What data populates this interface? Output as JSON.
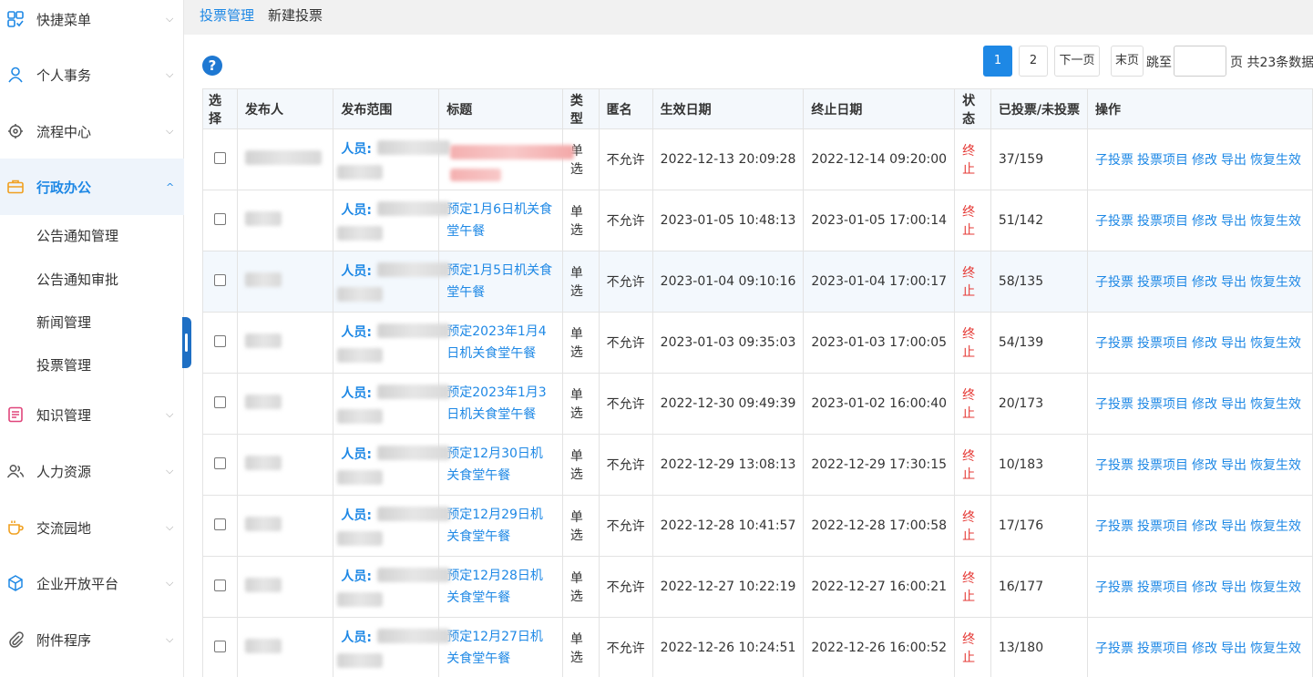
{
  "sidebar": {
    "menus": [
      {
        "label": "快捷菜单",
        "icon": "grid-check-icon"
      },
      {
        "label": "个人事务",
        "icon": "person-icon"
      },
      {
        "label": "流程中心",
        "icon": "workflow-icon"
      },
      {
        "label": "行政办公",
        "icon": "briefcase-icon",
        "active": true
      },
      {
        "label": "知识管理",
        "icon": "book-icon"
      },
      {
        "label": "人力资源",
        "icon": "people-icon"
      },
      {
        "label": "交流园地",
        "icon": "coffee-icon"
      },
      {
        "label": "企业开放平台",
        "icon": "cube-icon"
      },
      {
        "label": "附件程序",
        "icon": "paperclip-icon"
      }
    ],
    "submenu": [
      "公告通知管理",
      "公告通知审批",
      "新闻管理",
      "投票管理"
    ]
  },
  "topbar": {
    "tab1": "投票管理",
    "tab2": "新建投票"
  },
  "pager": {
    "page1": "1",
    "page2": "2",
    "next": "下一页",
    "last": "末页",
    "jump_label": "跳至",
    "page_suffix": "页 共23条数据"
  },
  "table": {
    "headers": [
      "选择",
      "发布人",
      "发布范围",
      "标题",
      "类型",
      "匿名",
      "生效日期",
      "终止日期",
      "状态",
      "已投票/未投票",
      "操作"
    ],
    "scope_prefix": "人员:",
    "ops": [
      "子投票",
      "投票项目",
      "修改",
      "导出",
      "恢复生效"
    ],
    "rows": [
      {
        "title": "",
        "type": "单选",
        "anon": "不允许",
        "start": "2022-12-13 20:09:28",
        "end": "2022-12-14 09:20:00",
        "status": "终止",
        "votes": "37/159"
      },
      {
        "title": "预定1月6日机关食堂午餐",
        "type": "单选",
        "anon": "不允许",
        "start": "2023-01-05 10:48:13",
        "end": "2023-01-05 17:00:14",
        "status": "终止",
        "votes": "51/142"
      },
      {
        "title": "预定1月5日机关食堂午餐",
        "type": "单选",
        "anon": "不允许",
        "start": "2023-01-04 09:10:16",
        "end": "2023-01-04 17:00:17",
        "status": "终止",
        "votes": "58/135"
      },
      {
        "title": "预定2023年1月4日机关食堂午餐",
        "type": "单选",
        "anon": "不允许",
        "start": "2023-01-03 09:35:03",
        "end": "2023-01-03 17:00:05",
        "status": "终止",
        "votes": "54/139"
      },
      {
        "title": "预定2023年1月3日机关食堂午餐",
        "type": "单选",
        "anon": "不允许",
        "start": "2022-12-30 09:49:39",
        "end": "2023-01-02 16:00:40",
        "status": "终止",
        "votes": "20/173"
      },
      {
        "title": "预定12月30日机关食堂午餐",
        "type": "单选",
        "anon": "不允许",
        "start": "2022-12-29 13:08:13",
        "end": "2022-12-29 17:30:15",
        "status": "终止",
        "votes": "10/183"
      },
      {
        "title": "预定12月29日机关食堂午餐",
        "type": "单选",
        "anon": "不允许",
        "start": "2022-12-28 10:41:57",
        "end": "2022-12-28 17:00:58",
        "status": "终止",
        "votes": "17/176"
      },
      {
        "title": "预定12月28日机关食堂午餐",
        "type": "单选",
        "anon": "不允许",
        "start": "2022-12-27 10:22:19",
        "end": "2022-12-27 16:00:21",
        "status": "终止",
        "votes": "16/177"
      },
      {
        "title": "预定12月27日机关食堂午餐",
        "type": "单选",
        "anon": "不允许",
        "start": "2022-12-26 10:24:51",
        "end": "2022-12-26 16:00:52",
        "status": "终止",
        "votes": "13/180"
      }
    ]
  }
}
